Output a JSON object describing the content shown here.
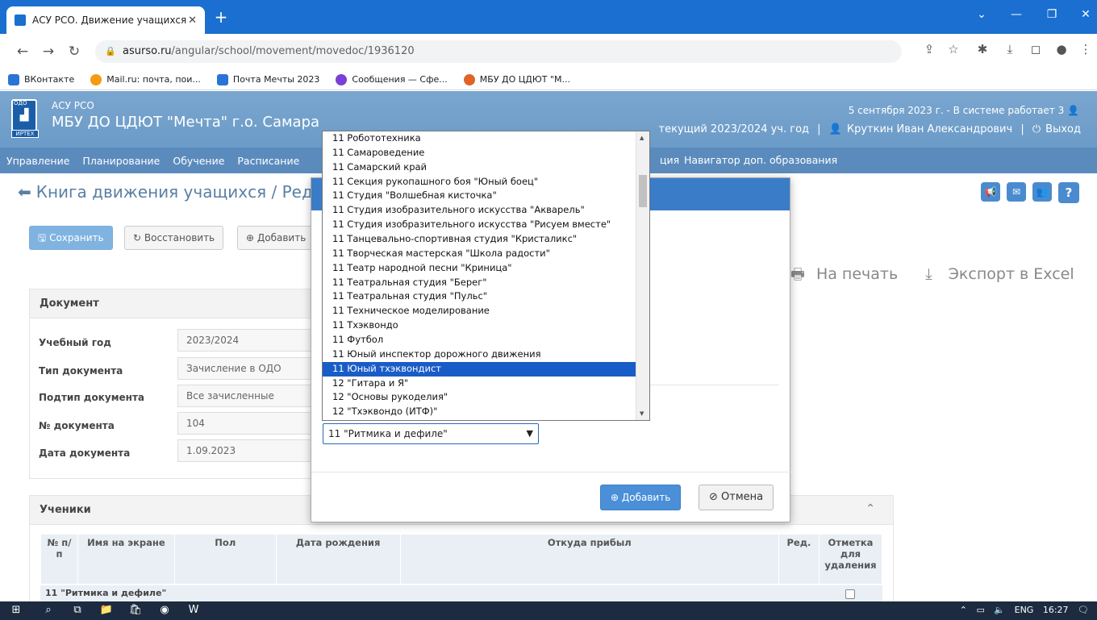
{
  "browser": {
    "tab_title": "АСУ РСО. Движение учащихся",
    "url_host": "asurso.ru",
    "url_path": "/angular/school/movement/movedoc/1936120",
    "bookmarks": [
      "ВКонтакте",
      "Mail.ru: почта, пои...",
      "Почта Мечты 2023",
      "Сообщения — Сфе...",
      "МБУ ДО ЦДЮТ \"М..."
    ]
  },
  "header": {
    "logo_top": "ОДО",
    "logo_bottom": "ИРТЕХ",
    "system_name": "АСУ РСО",
    "org_name": "МБУ ДО ЦДЮТ \"Мечта\" г.о. Самара",
    "date_status": "5 сентября 2023 г. - В системе работает 3",
    "year": "текущий 2023/2024 уч. год",
    "user": "Круткин Иван Александрович",
    "logout": "Выход"
  },
  "menu": {
    "items": [
      "Управление",
      "Планирование",
      "Обучение",
      "Расписание"
    ],
    "fragment": "ция",
    "right": "Навигатор доп. образования"
  },
  "page": {
    "title": "Книга движения учащихся / Редакт",
    "save": "Сохранить",
    "restore": "Восстановить",
    "add": "Добавить",
    "print": "На печать",
    "export": "Экспорт в Excel"
  },
  "document": {
    "heading": "Документ",
    "fields": [
      {
        "label": "Учебный год",
        "value": "2023/2024"
      },
      {
        "label": "Тип документа",
        "value": "Зачисление в ОДО"
      },
      {
        "label": "Подтип документа",
        "value": "Все зачисленные"
      },
      {
        "label": "№ документа",
        "value": "104"
      },
      {
        "label": "Дата документа",
        "value": "1.09.2023"
      }
    ]
  },
  "students": {
    "heading": "Ученики",
    "columns": [
      "№ п/п",
      "Имя на экране",
      "Пол",
      "Дата рождения",
      "Откуда прибыл",
      "Ред.",
      "Отметка для удаления"
    ],
    "group": "11 \"Ритмика и дефиле\""
  },
  "modal": {
    "selected": "11 \"Ритмика и дефиле\"",
    "add": "Добавить",
    "cancel": "Отмена"
  },
  "dropdown": {
    "selected_index": 16,
    "items": [
      "11 Робототехника",
      "11 Самароведение",
      "11 Самарский край",
      "11 Секция рукопашного боя \"Юный боец\"",
      "11 Студия \"Волшебная кисточка\"",
      "11 Студия изобразительного искусства \"Акварель\"",
      "11 Студия изобразительного искусства \"Рисуем вместе\"",
      "11 Танцевально-спортивная студия \"Кристаликс\"",
      "11 Творческая мастерская \"Школа радости\"",
      "11 Театр народной песни \"Криница\"",
      "11 Театральная студия \"Берег\"",
      "11 Театральная студия \"Пульс\"",
      "11 Техническое моделирование",
      "11 Тхэквондо",
      "11 Футбол",
      "11 Юный инспектор дорожного движения",
      "11 Юный тхэквондист",
      "12 \"Гитара и Я\"",
      "12 \"Основы рукоделия\"",
      "12 \"Тхэквондо (ИТФ)\""
    ]
  },
  "taskbar": {
    "lang": "ENG",
    "time": "16:27"
  }
}
